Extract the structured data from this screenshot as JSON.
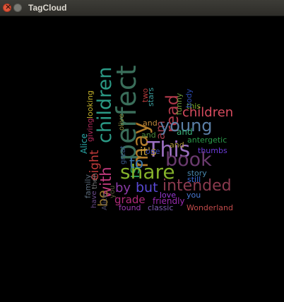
{
  "window": {
    "title": "TagCloud"
  },
  "words": [
    {
      "text": "perfect",
      "color": "#3a6e5a"
    },
    {
      "text": "children",
      "color": "#2b9a86"
    },
    {
      "text": "young",
      "color": "#5b7fa6"
    },
    {
      "text": "children",
      "color": "#d64b5e"
    },
    {
      "text": "read",
      "color": "#b0394a"
    },
    {
      "text": "This",
      "color": "#9a6fbf"
    },
    {
      "text": "book",
      "color": "#6a3a6e"
    },
    {
      "text": "share",
      "color": "#84b02a"
    },
    {
      "text": "intended",
      "color": "#8a3a4e"
    },
    {
      "text": "by",
      "color": "#8a3aa6"
    },
    {
      "text": "but",
      "color": "#5a4ad6"
    },
    {
      "text": "it's",
      "color": "#bf9a3a"
    },
    {
      "text": "may",
      "color": "#b07a2a"
    },
    {
      "text": "with",
      "color": "#c23a7e"
    },
    {
      "text": "eight",
      "color": "#c23a3a"
    },
    {
      "text": "be",
      "color": "#9a7a2a"
    },
    {
      "text": "to",
      "color": "#3a7ab0"
    },
    {
      "text": "is",
      "color": "#2a9a5a"
    },
    {
      "text": "grade",
      "color": "#b02a7a"
    },
    {
      "text": "friendly",
      "color": "#9a2ab0"
    },
    {
      "text": "found",
      "color": "#9a3ab0"
    },
    {
      "text": "classic",
      "color": "#7a5ab0"
    },
    {
      "text": "Wonderland",
      "color": "#c24a4a"
    },
    {
      "text": "love",
      "color": "#9a3ad6"
    },
    {
      "text": "you",
      "color": "#4a7ad6"
    },
    {
      "text": "story",
      "color": "#4a8ab0"
    },
    {
      "text": "still",
      "color": "#3a6ad6"
    },
    {
      "text": "thumbs",
      "color": "#6a3ad6"
    },
    {
      "text": "antergetic",
      "color": "#2a9a4a"
    },
    {
      "text": "and",
      "color": "#3ab07a"
    },
    {
      "text": "and",
      "color": "#c28a3a"
    },
    {
      "text": "this",
      "color": "#7ab02a"
    },
    {
      "text": "funny",
      "color": "#6a9a3a"
    },
    {
      "text": "body",
      "color": "#2a4ab0"
    },
    {
      "text": "am",
      "color": "#9a3a4a"
    },
    {
      "text": "two",
      "color": "#b03a3a"
    },
    {
      "text": "stars",
      "color": "#3a9a9a"
    },
    {
      "text": "and",
      "color": "#b09a3a"
    },
    {
      "text": "one",
      "color": "#3a4ab0"
    },
    {
      "text": "Alice",
      "color": "#2aa6a6"
    },
    {
      "text": "giving",
      "color": "#b02a5a"
    },
    {
      "text": "looking",
      "color": "#c2b02a"
    },
    {
      "text": "family",
      "color": "#5a6a7a"
    },
    {
      "text": "have",
      "color": "#6a4a8a"
    },
    {
      "text": "then",
      "color": "#7a7a7a"
    },
    {
      "text": "Alice",
      "color": "#4a4a6a"
    },
    {
      "text": "you",
      "color": "#5a5a3a"
    },
    {
      "text": "olive",
      "color": "#8a8a3a"
    },
    {
      "text": "great",
      "color": "#3a5a8a"
    },
    {
      "text": "and",
      "color": "#4a8a3a"
    }
  ]
}
